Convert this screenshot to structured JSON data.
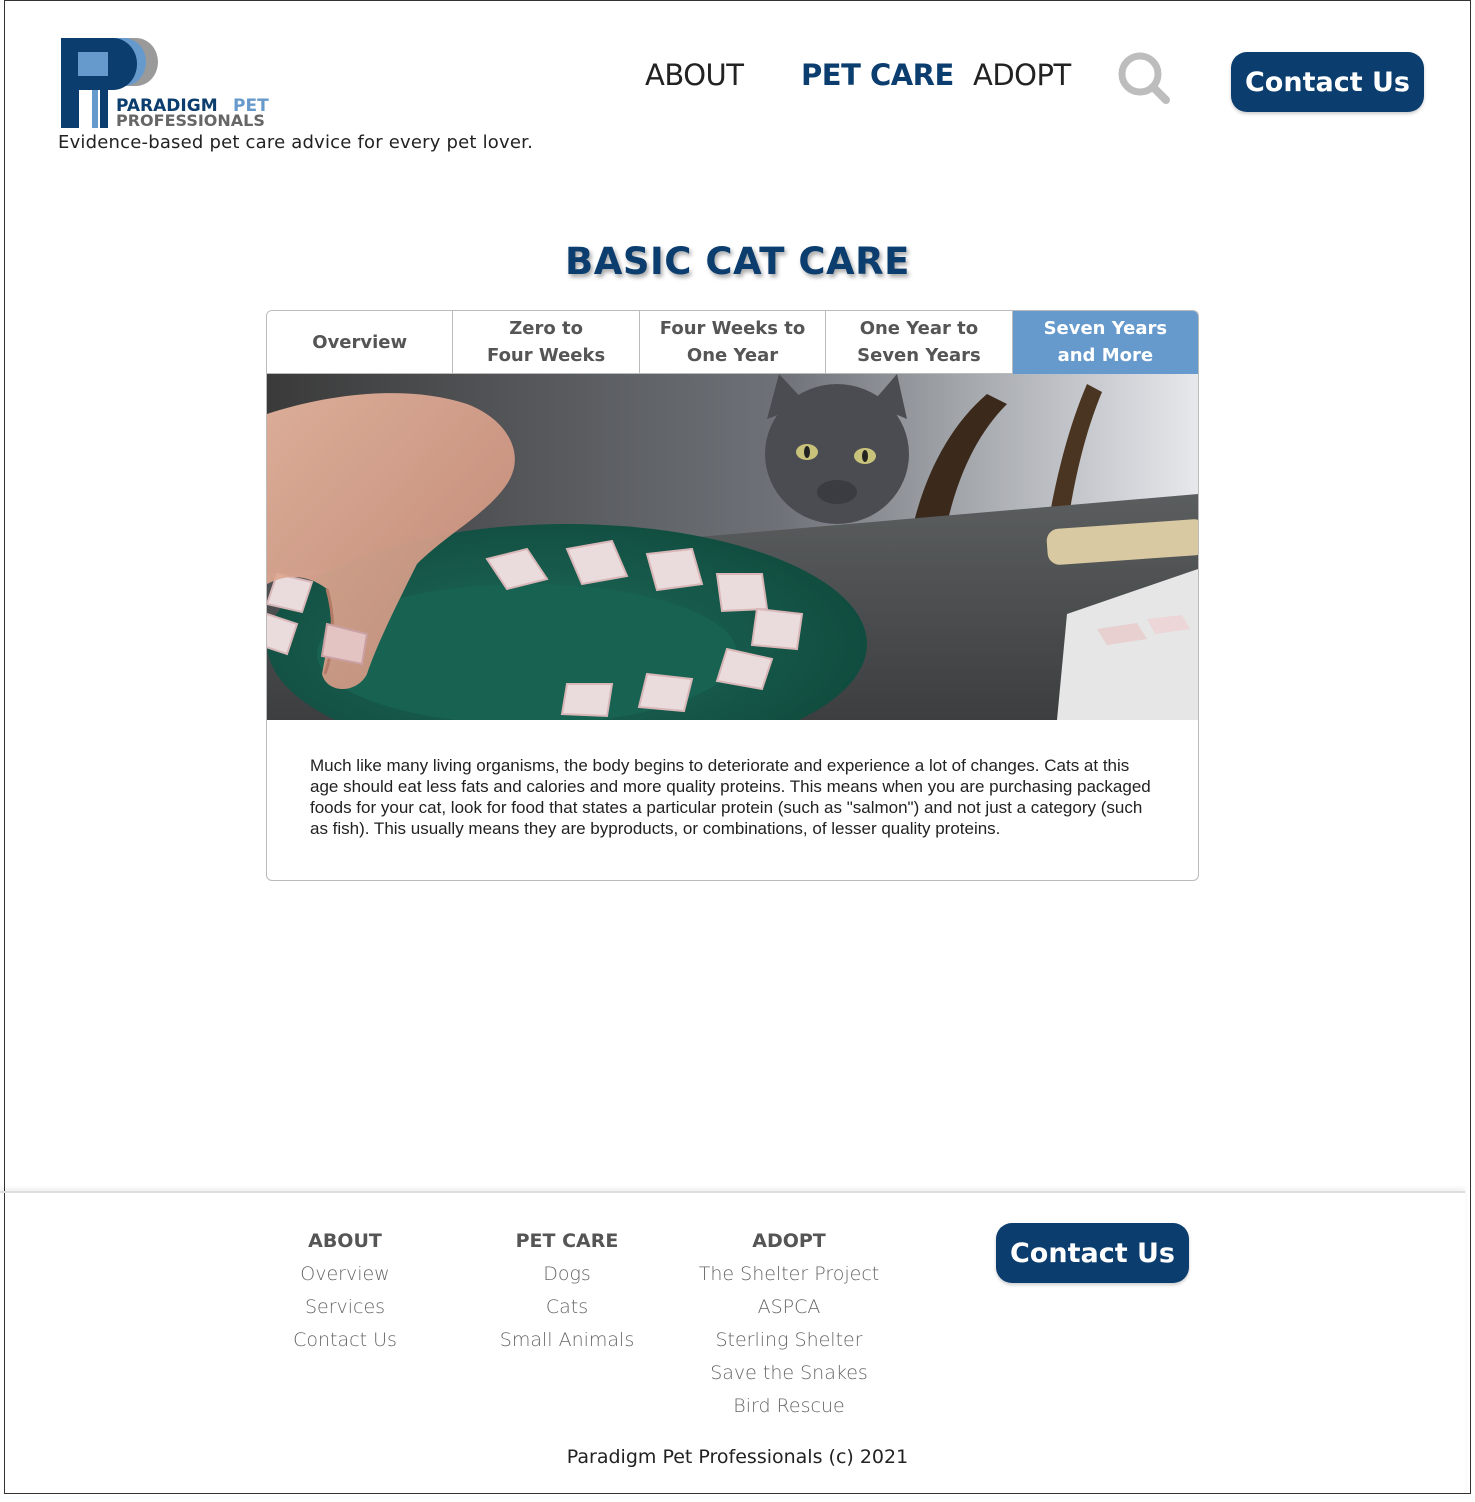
{
  "brand": {
    "logo_line1": "PARADIGM",
    "logo_line1_accent": "PET",
    "logo_line2": "PROFESSIONALS",
    "tagline": "Evidence-based pet care advice for every pet lover.",
    "colors": {
      "navy": "#0b3d6e",
      "accent_blue": "#6699cc",
      "gray": "#777777"
    }
  },
  "nav": {
    "about": "ABOUT",
    "pet_care": "PET CARE",
    "adopt": "ADOPT",
    "search_icon": "search-icon",
    "contact": "Contact Us"
  },
  "page": {
    "title": "BASIC CAT CARE"
  },
  "tabs": [
    {
      "label": "Overview",
      "active": false
    },
    {
      "label": "Zero to\nFour Weeks",
      "active": false
    },
    {
      "label": "Four Weeks to\nOne Year",
      "active": false
    },
    {
      "label": "One Year to\nSeven Years",
      "active": false
    },
    {
      "label": "Seven Years\nand More",
      "active": true
    }
  ],
  "content": {
    "image": "photo of a gray cat watching a hand place fish slices on a green plate",
    "description": "Much like many living organisms, the body begins to deteriorate and experience a lot of changes. Cats at this age should eat less fats and calories and more quality proteins. This means when you are purchasing packaged foods for your cat, look for food that states a particular protein (such as \"salmon\") and not just a category (such as fish). This usually means they are byproducts, or combinations, of lesser quality proteins."
  },
  "footer": {
    "columns": [
      {
        "heading": "ABOUT",
        "links": [
          "Overview",
          "Services",
          "Contact Us"
        ]
      },
      {
        "heading": "PET CARE",
        "links": [
          "Dogs",
          "Cats",
          "Small Animals"
        ]
      },
      {
        "heading": "ADOPT",
        "links": [
          "The Shelter Project",
          "ASPCA",
          "Sterling Shelter",
          "Save the Snakes",
          "Bird Rescue"
        ]
      }
    ],
    "contact": "Contact Us",
    "copyright": "Paradigm Pet Professionals (c) 2021"
  }
}
